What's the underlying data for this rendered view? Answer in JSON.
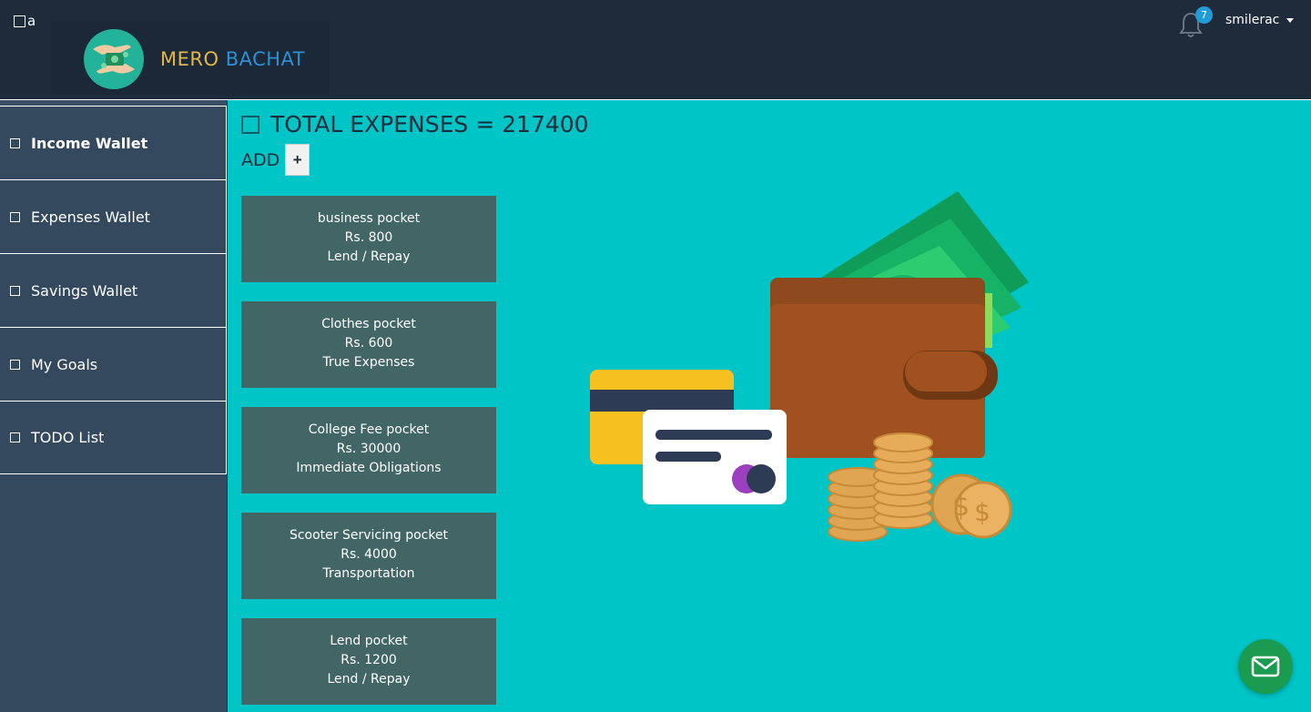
{
  "header": {
    "toggle_glyph": "a",
    "logo_word1": "MERO",
    "logo_word2": "BACHAT",
    "notification_count": "7",
    "username": "smilerac"
  },
  "sidebar": {
    "items": [
      {
        "label": "Income Wallet",
        "active": true
      },
      {
        "label": "Expenses Wallet",
        "active": false
      },
      {
        "label": "Savings Wallet",
        "active": false
      },
      {
        "label": "My Goals",
        "active": false
      },
      {
        "label": "TODO List",
        "active": false
      }
    ]
  },
  "main": {
    "heading": "TOTAL EXPENSES = 217400",
    "add_label": "ADD",
    "add_button": "+",
    "pockets": [
      {
        "name": "business pocket",
        "amount": "Rs. 800",
        "category": "Lend / Repay"
      },
      {
        "name": "Clothes pocket",
        "amount": "Rs. 600",
        "category": "True Expenses"
      },
      {
        "name": "College Fee pocket",
        "amount": "Rs. 30000",
        "category": "Immediate Obligations"
      },
      {
        "name": "Scooter Servicing pocket",
        "amount": "Rs. 4000",
        "category": "Transportation"
      },
      {
        "name": "Lend pocket",
        "amount": "Rs. 1200",
        "category": "Lend / Repay"
      }
    ]
  },
  "icons": {
    "menu_toggle": "square-icon",
    "notification": "bell-icon",
    "user_dropdown": "caret-down-icon",
    "sidebar_item": "square-icon",
    "chat": "mail-icon"
  },
  "colors": {
    "topbar_bg": "#1e2b3a",
    "sidebar_bg": "#34495e",
    "main_bg": "#00c5c7",
    "card_bg": "#426665",
    "logo_word1": "#e3b54a",
    "logo_word2": "#2f8fd4",
    "badge_bg": "#1f9bd8",
    "fab_bg": "#1a9b4f"
  }
}
